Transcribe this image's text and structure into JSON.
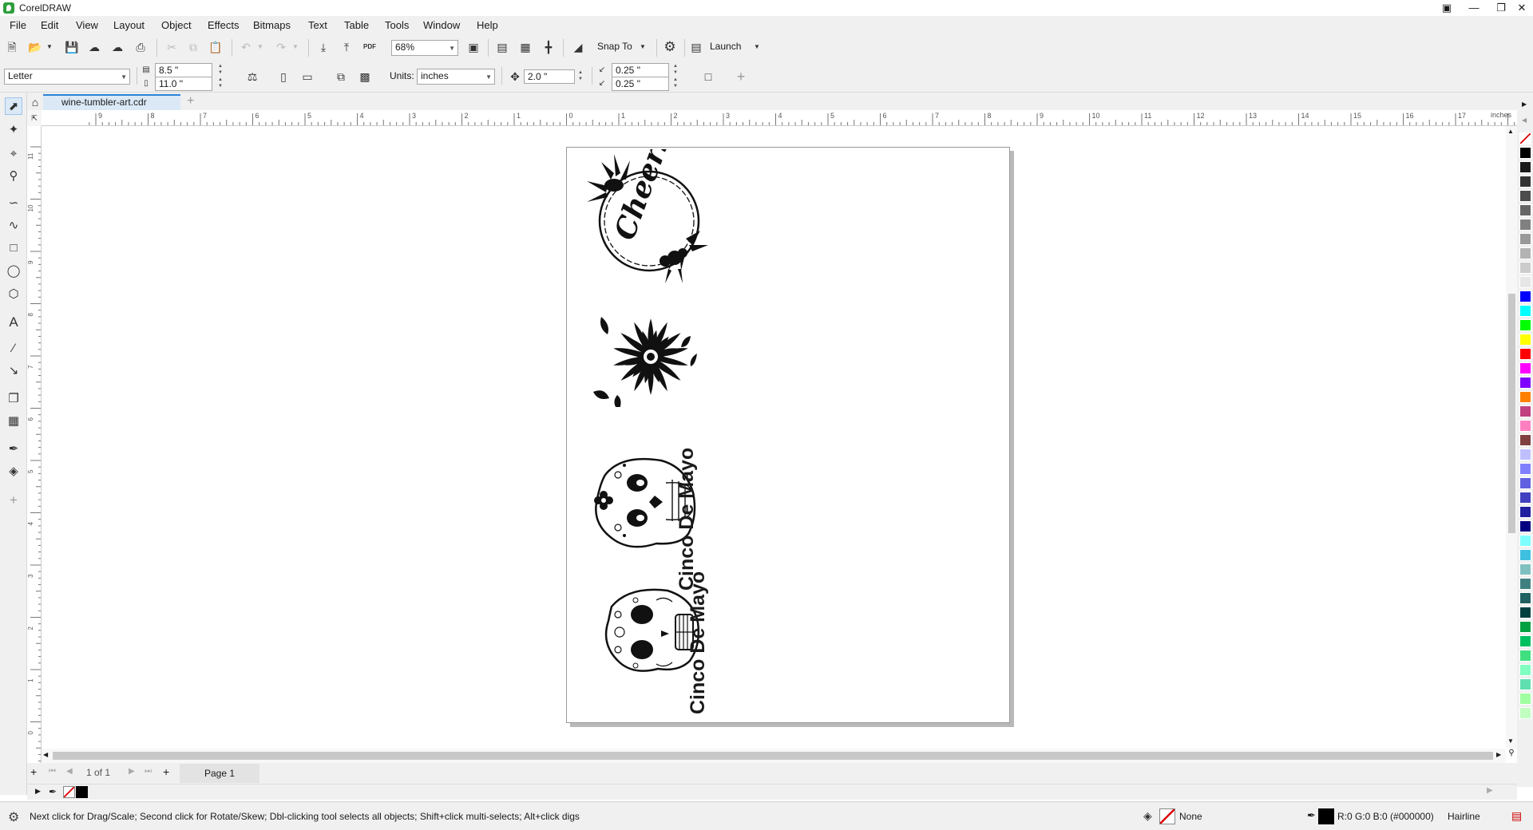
{
  "app": {
    "title": "CorelDRAW"
  },
  "menu": [
    "File",
    "Edit",
    "View",
    "Layout",
    "Object",
    "Effects",
    "Bitmaps",
    "Text",
    "Table",
    "Tools",
    "Window",
    "Help"
  ],
  "toolbar": {
    "zoom": "68%",
    "snap_label": "Snap To",
    "launch_label": "Launch",
    "pdf_label": "PDF"
  },
  "propbar": {
    "page_size": "Letter",
    "width": "8.5 \"",
    "height": "11.0 \"",
    "units_label": "Units:",
    "units_value": "inches",
    "nudge": "2.0 \"",
    "dup_x": "0.25 \"",
    "dup_y": "0.25 \""
  },
  "tab": {
    "filename": "wine-tumbler-art.cdr"
  },
  "ruler": {
    "unit": "inches",
    "h_labels": [
      "9",
      "8",
      "7",
      "6",
      "5",
      "4",
      "3",
      "2",
      "1",
      "0",
      "1",
      "2",
      "3",
      "4",
      "5",
      "6",
      "7",
      "8",
      "9",
      "10",
      "11",
      "12",
      "13",
      "14",
      "15",
      "16",
      "17"
    ],
    "v_labels": [
      "11",
      "10",
      "9",
      "8",
      "7",
      "6",
      "5",
      "4",
      "3",
      "2",
      "1",
      "0"
    ]
  },
  "artwork": {
    "wreath_text": "Cheers",
    "skull1_text": "Cinco De Mayo",
    "skull2_text": "Cinco De Mayo"
  },
  "pagenav": {
    "counter": "1 of 1",
    "page_tab": "Page 1"
  },
  "status": {
    "hint": "Next click for Drag/Scale; Second click for Rotate/Skew; Dbl-clicking tool selects all objects; Shift+click multi-selects; Alt+click digs",
    "fill_label": "None",
    "outline_color": "R:0 G:0 B:0 (#000000)",
    "outline_width": "Hairline"
  },
  "palette_colors": [
    "#ffffff",
    "#000000",
    "#1a1a1a",
    "#333333",
    "#4d4d4d",
    "#666666",
    "#808080",
    "#999999",
    "#b3b3b3",
    "#cccccc",
    "#e6e6e6",
    "#0000ff",
    "#00ffff",
    "#00ff00",
    "#ffff00",
    "#ff0000",
    "#ff00ff",
    "#8000ff",
    "#ff8000",
    "#c04080",
    "#ff80c0",
    "#7f3f3f",
    "#bfbfff",
    "#8080ff",
    "#6060e0",
    "#4040c0",
    "#2020a0",
    "#000080",
    "#80ffff",
    "#40c0e0",
    "#80c0c0",
    "#408080",
    "#206060",
    "#004040",
    "#00a040",
    "#00c060",
    "#40e080",
    "#80ffc0",
    "#60e0b0",
    "#a0ffa0",
    "#c0ffc0"
  ]
}
